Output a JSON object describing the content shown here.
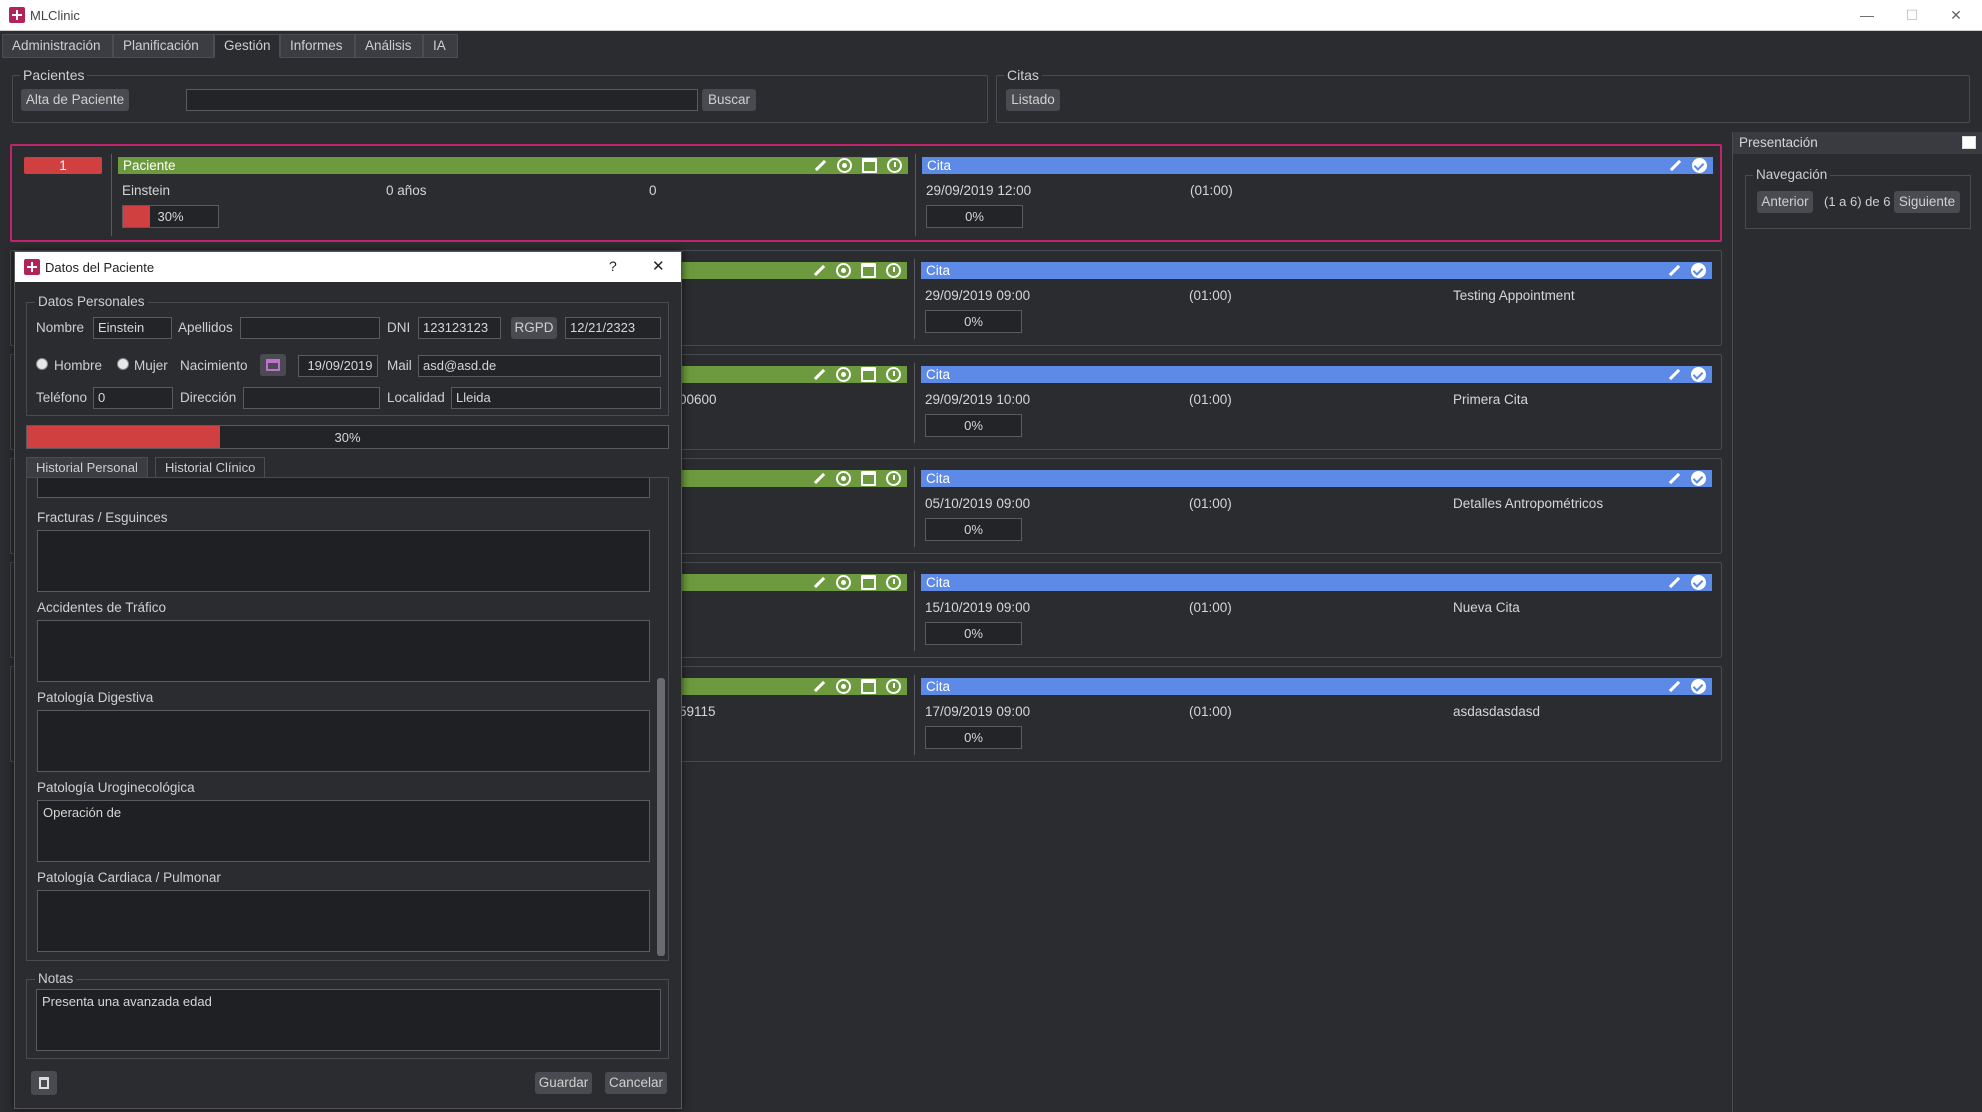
{
  "window": {
    "title": "MLClinic",
    "minimize": "—",
    "maximize": "☐",
    "close": "✕"
  },
  "menu": [
    "Administración",
    "Planificación",
    "Gestión",
    "Informes",
    "Análisis",
    "IA"
  ],
  "pacientes": {
    "title": "Pacientes",
    "alta": "Alta de Paciente",
    "search_value": "",
    "buscar": "Buscar"
  },
  "citas": {
    "title": "Citas",
    "listado": "Listado"
  },
  "first_card": {
    "number": "1",
    "patient_label": "Paciente",
    "name": "Einstein",
    "age": "0 años",
    "phone": "0",
    "progress_label": "30%",
    "progress": 0.3,
    "cita_label": "Cita",
    "date": "29/09/2019 12:00",
    "duration": "(01:00)",
    "cita_progress": "0%"
  },
  "cards": [
    {
      "extra": "",
      "cita_label": "Cita",
      "date": "29/09/2019 09:00",
      "duration": "(01:00)",
      "desc": "Testing Appointment",
      "progress": "0%"
    },
    {
      "extra": "00600",
      "cita_label": "Cita",
      "date": "29/09/2019 10:00",
      "duration": "(01:00)",
      "desc": "Primera Cita",
      "progress": "0%"
    },
    {
      "extra": "",
      "cita_label": "Cita",
      "date": "05/10/2019 09:00",
      "duration": "(01:00)",
      "desc": "Detalles Antropométricos",
      "progress": "0%"
    },
    {
      "extra": "",
      "cita_label": "Cita",
      "date": "15/10/2019 09:00",
      "duration": "(01:00)",
      "desc": "Nueva Cita",
      "progress": "0%"
    },
    {
      "extra": "59115",
      "cita_label": "Cita",
      "date": "17/09/2019 09:00",
      "duration": "(01:00)",
      "desc": "asdasdasdasd",
      "progress": "0%"
    }
  ],
  "presentacion": {
    "title": "Presentación",
    "nav_title": "Navegación",
    "anterior": "Anterior",
    "range": "(1 a 6) de 6",
    "siguiente": "Siguiente"
  },
  "dialog": {
    "title": "Datos del Paciente",
    "help": "?",
    "close": "✕",
    "personal_title": "Datos Personales",
    "nombre_label": "Nombre",
    "nombre": "Einstein",
    "apellidos_label": "Apellidos",
    "apellidos": "",
    "dni_label": "DNI",
    "dni": "123123123",
    "rgpd": "RGPD",
    "rgpd_date": "12/21/2323",
    "hombre": "Hombre",
    "mujer": "Mujer",
    "nacimiento_label": "Nacimiento",
    "nacimiento": "19/09/2019",
    "mail_label": "Mail",
    "mail": "asd@asd.de",
    "telefono_label": "Teléfono",
    "telefono": "0",
    "direccion_label": "Dirección",
    "direccion": "",
    "localidad_label": "Localidad",
    "localidad": "Lleida",
    "progress_label": "30%",
    "progress": 0.3,
    "tabs": [
      "Historial Personal",
      "Historial Clínico"
    ],
    "sections": [
      {
        "label": "Fracturas / Esguinces",
        "value": ""
      },
      {
        "label": "Accidentes de Tráfico",
        "value": ""
      },
      {
        "label": "Patología Digestiva",
        "value": ""
      },
      {
        "label": "Patología Uroginecológica",
        "value": "Operación de"
      },
      {
        "label": "Patología Cardiaca / Pulmonar",
        "value": ""
      }
    ],
    "notas_title": "Notas",
    "notas": "Presenta una avanzada edad",
    "guardar": "Guardar",
    "cancelar": "Cancelar"
  },
  "colors": {
    "patient_bar": "#6d9a3e",
    "cita_bar": "#5c8ae6",
    "selected_border": "#c0246c",
    "progress_red": "#d04040"
  }
}
